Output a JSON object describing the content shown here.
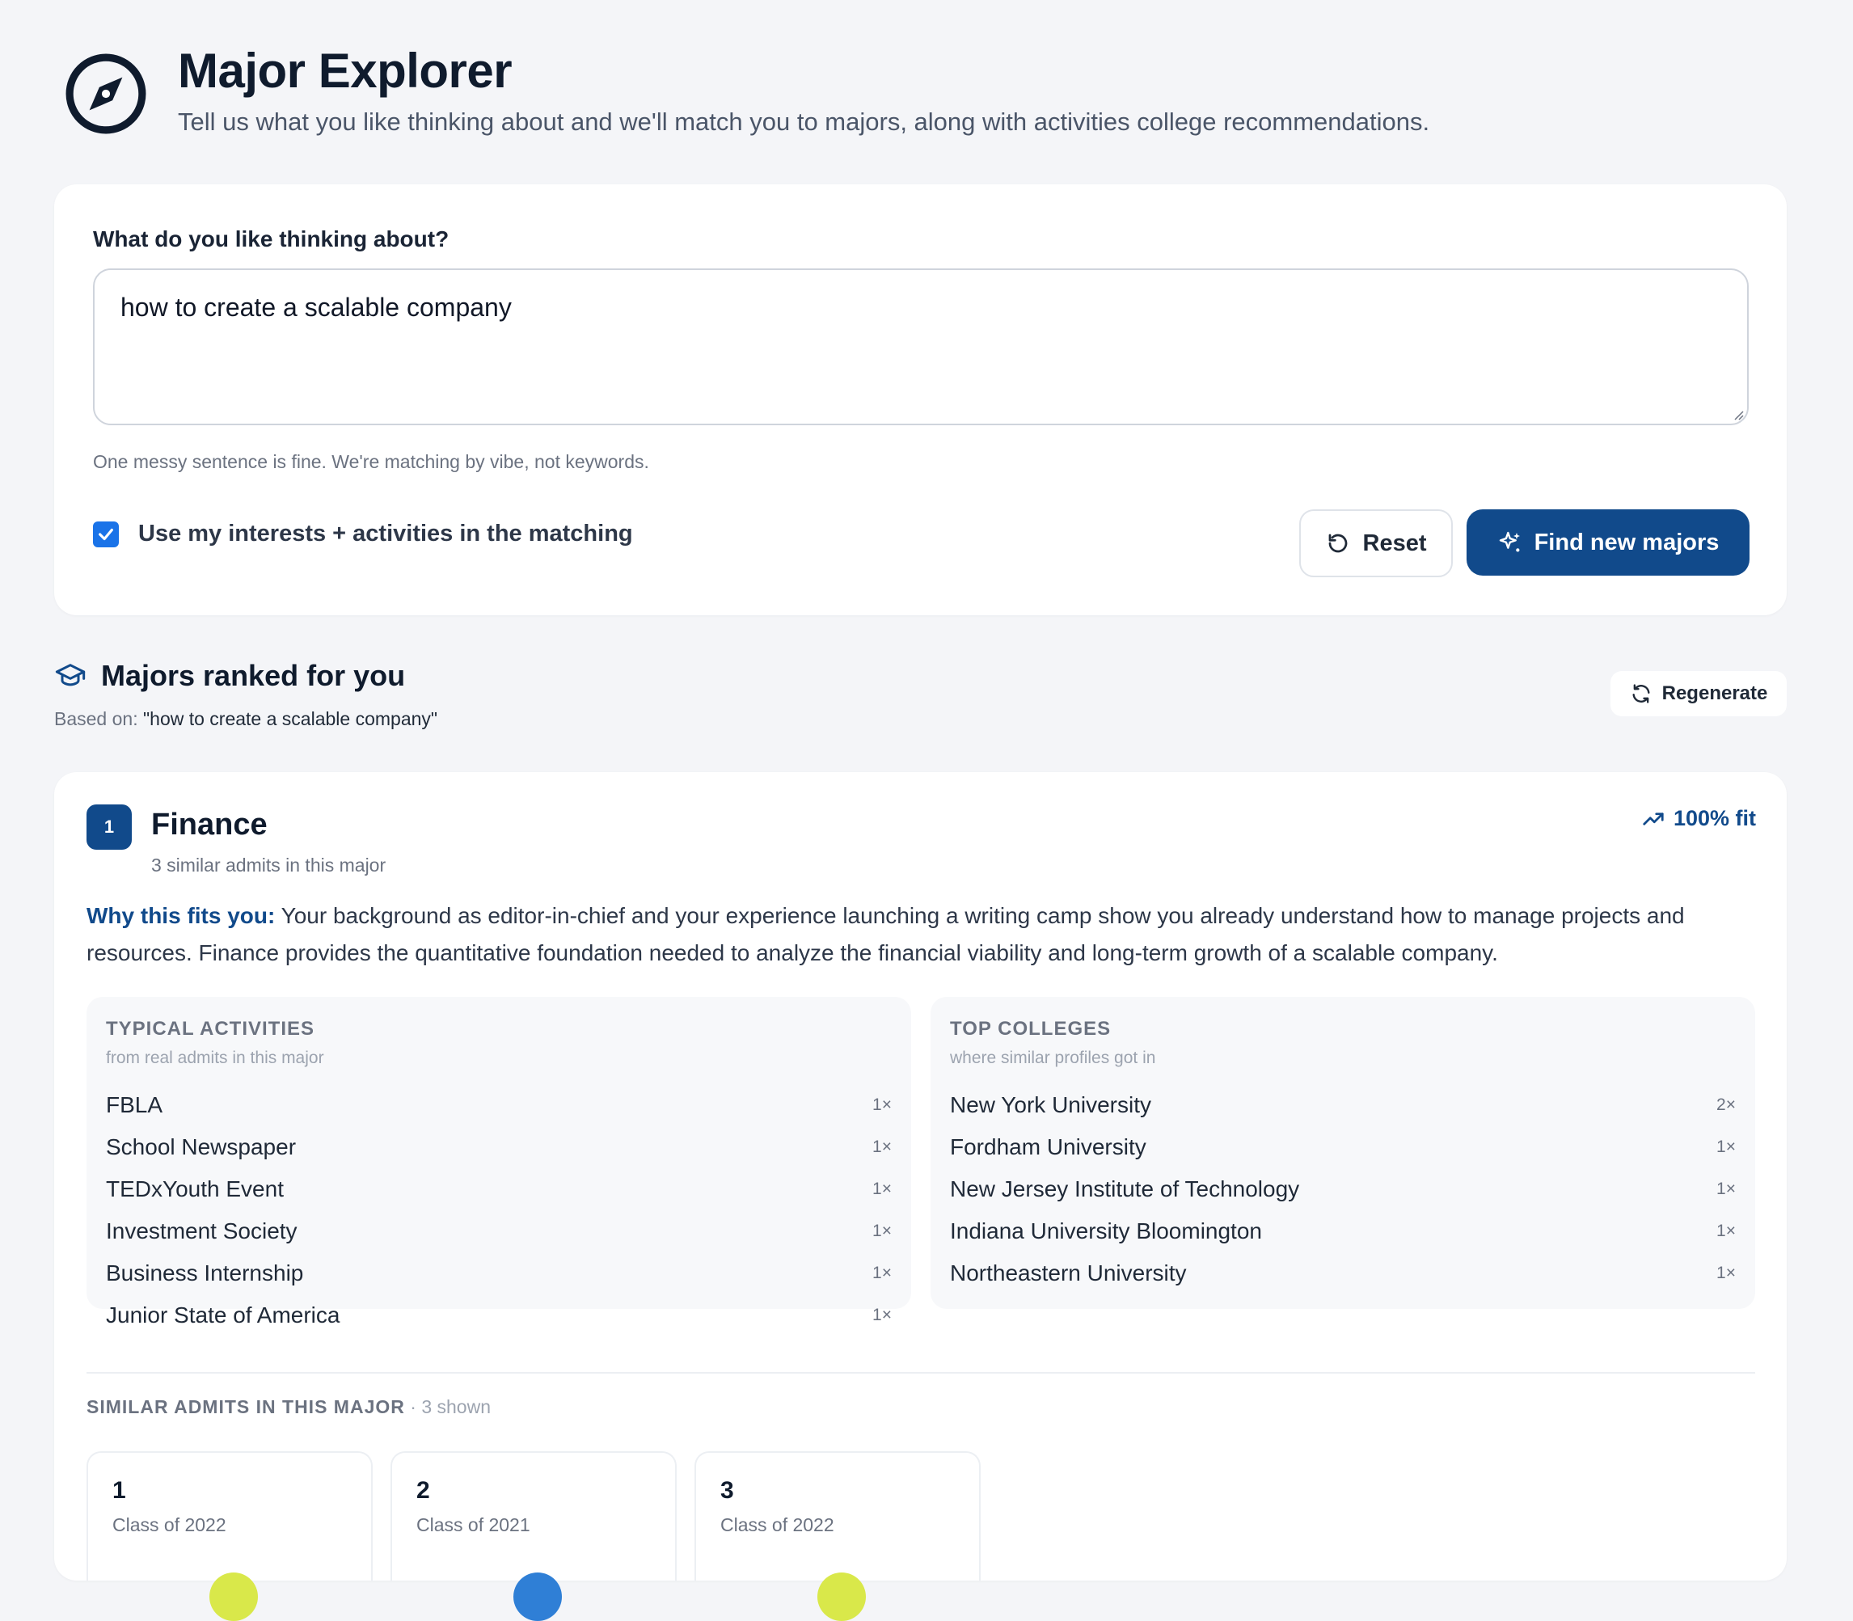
{
  "header": {
    "title": "Major Explorer",
    "subtitle": "Tell us what you like thinking about and we'll match you to majors, along with activities college recommendations."
  },
  "input": {
    "label": "What do you like thinking about?",
    "value": "how to create a scalable company",
    "hint": "One messy sentence is fine. We're matching by vibe, not keywords.",
    "checkbox_label": "Use my interests + activities in the matching",
    "checkbox_checked": true,
    "reset_label": "Reset",
    "find_label": "Find new majors"
  },
  "results": {
    "title": "Majors ranked for you",
    "based_on_label": "Based on:",
    "based_on_query": "\"how to create a scalable company\"",
    "regenerate_label": "Regenerate"
  },
  "major": {
    "rank": "1",
    "name": "Finance",
    "admits_count": "3 similar admits in this major",
    "fit": "100% fit",
    "why_label": "Why this fits you:",
    "why_text": " Your background as editor-in-chief and your experience launching a writing camp show you already understand how to manage projects and resources. Finance provides the quantitative foundation needed to analyze the financial viability and long-term growth of a scalable company.",
    "activities": {
      "title": "TYPICAL ACTIVITIES",
      "subtitle": "from real admits in this major",
      "items": [
        {
          "name": "FBLA",
          "count": "1×"
        },
        {
          "name": "School Newspaper",
          "count": "1×"
        },
        {
          "name": "TEDxYouth Event",
          "count": "1×"
        },
        {
          "name": "Investment Society",
          "count": "1×"
        },
        {
          "name": "Business Internship",
          "count": "1×"
        },
        {
          "name": "Junior State of America",
          "count": "1×"
        }
      ]
    },
    "colleges": {
      "title": "TOP COLLEGES",
      "subtitle": "where similar profiles got in",
      "items": [
        {
          "name": "New York University",
          "count": "2×"
        },
        {
          "name": "Fordham University",
          "count": "1×"
        },
        {
          "name": "New Jersey Institute of Technology",
          "count": "1×"
        },
        {
          "name": "Indiana University Bloomington",
          "count": "1×"
        },
        {
          "name": "Northeastern University",
          "count": "1×"
        }
      ]
    },
    "similar_admits": {
      "label": "SIMILAR ADMITS IN THIS MAJOR",
      "shown": " · 3 shown",
      "items": [
        {
          "num": "1",
          "class": "Class of 2022",
          "color": "#d9e84a"
        },
        {
          "num": "2",
          "class": "Class of 2021",
          "color": "#2f7fd6"
        },
        {
          "num": "3",
          "class": "Class of 2022",
          "color": "#d9e84a"
        }
      ]
    }
  },
  "colors": {
    "primary": "#114a8b",
    "checkbox": "#1a73e8",
    "background": "#f4f5f8"
  }
}
